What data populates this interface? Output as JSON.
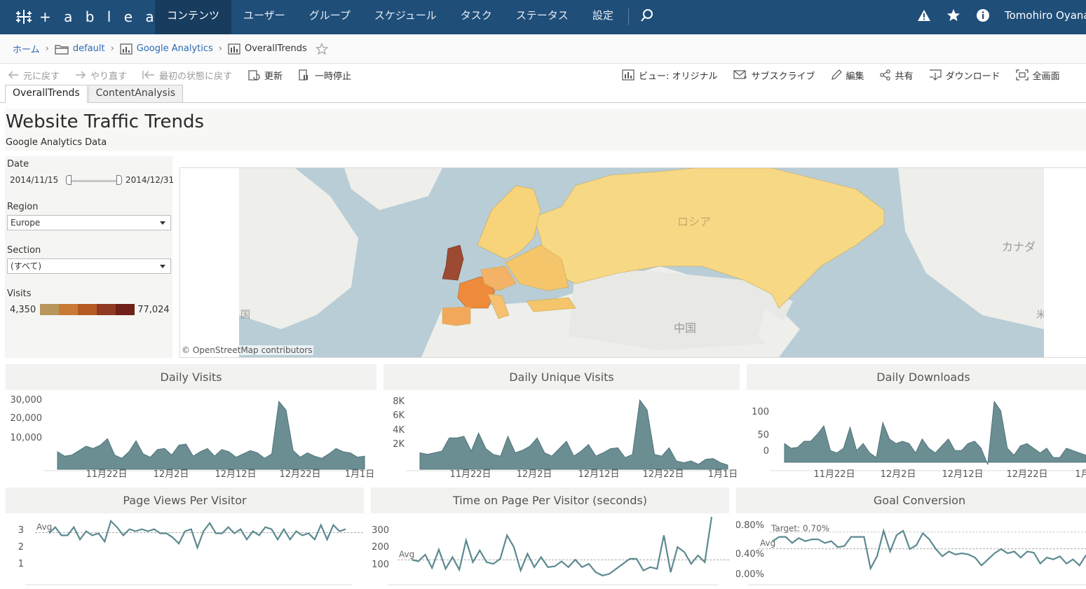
{
  "topnav": {
    "logo_text": "+ a b l e a u",
    "items": [
      {
        "label": "コンテンツ",
        "active": true
      },
      {
        "label": "ユーザー",
        "active": false
      },
      {
        "label": "グループ",
        "active": false
      },
      {
        "label": "スケジュール",
        "active": false
      },
      {
        "label": "タスク",
        "active": false
      },
      {
        "label": "ステータス",
        "active": false
      },
      {
        "label": "設定",
        "active": false
      }
    ],
    "user_name": "Tomohiro Oyana",
    "colors": {
      "bar": "#1f4e79",
      "active": "#173c5e"
    }
  },
  "breadcrumb": {
    "home": "ホーム",
    "project": "default",
    "workbook": "Google Analytics",
    "view": "OverallTrends"
  },
  "toolbar": {
    "undo": "元に戻す",
    "redo": "やり直す",
    "revert": "最初の状態に戻す",
    "refresh": "更新",
    "pause": "一時停止",
    "view": "ビュー: オリジナル",
    "subscribe": "サブスクライブ",
    "edit": "編集",
    "share": "共有",
    "download": "ダウンロード",
    "fullscreen": "全画面"
  },
  "tabs": [
    "OverallTrends",
    "ContentAnalysis"
  ],
  "dashboard": {
    "title": "Website Traffic Trends",
    "subtitle": "Google Analytics Data",
    "filters": {
      "date_label": "Date",
      "date_start": "2014/11/15",
      "date_end": "2014/12/31",
      "region_label": "Region",
      "region_value": "Europe",
      "section_label": "Section",
      "section_value": "(すべて)",
      "visits_label": "Visits",
      "visits_min": "4,350",
      "visits_max": "77,024",
      "legend_colors": [
        "#b8955a",
        "#c97a36",
        "#b55a25",
        "#8f3a22",
        "#6e2019"
      ]
    },
    "map": {
      "credit": "© OpenStreetMap contributors",
      "labels": {
        "russia": "ロシア",
        "china": "中国",
        "canada": "カナダ",
        "country_partial": "国",
        "partial_rus": "米"
      }
    }
  },
  "chart_data": [
    {
      "type": "area",
      "title": "Daily Visits",
      "xticks": [
        "11月22日",
        "12月2日",
        "12月12日",
        "12月22日",
        "1月1日"
      ],
      "yticks": [
        "30,000",
        "20,000",
        "10,000"
      ],
      "ylim": [
        0,
        32000
      ],
      "values": [
        8000,
        6000,
        6500,
        8500,
        10500,
        9500,
        11000,
        14000,
        6500,
        5000,
        8000,
        13000,
        7000,
        5500,
        9000,
        9500,
        6500,
        11000,
        11500,
        6000,
        8000,
        9500,
        6000,
        9000,
        8000,
        5500,
        7000,
        8500,
        7500,
        5000,
        7000,
        31000,
        27000,
        8500,
        5500,
        7500,
        6000,
        5000,
        7000,
        9500,
        8000,
        7500,
        5500,
        6000
      ]
    },
    {
      "type": "area",
      "title": "Daily Unique Visits",
      "xticks": [
        "11月22日",
        "12月2日",
        "12月12日",
        "12月22日",
        "1月1日"
      ],
      "yticks": [
        "8K",
        "6K",
        "4K",
        "2K"
      ],
      "ylim": [
        0,
        8500
      ],
      "values": [
        2000,
        1800,
        2000,
        2200,
        3800,
        3800,
        4000,
        2200,
        4400,
        2500,
        1800,
        1600,
        4000,
        2000,
        2300,
        2800,
        3800,
        2000,
        1600,
        2500,
        3400,
        1600,
        2200,
        3000,
        1600,
        2000,
        2500,
        2600,
        1400,
        1800,
        8400,
        7200,
        1800,
        1600,
        2600,
        1000,
        800,
        1000,
        600,
        1200,
        1300,
        800,
        500
      ]
    },
    {
      "type": "area",
      "title": "Daily Downloads",
      "xticks": [
        "11月22日",
        "12月2日",
        "12月12日",
        "12月22日",
        "1月"
      ],
      "yticks": [
        "100",
        "50",
        "0"
      ],
      "ylim": [
        -15,
        135
      ],
      "values": [
        40,
        30,
        32,
        45,
        45,
        60,
        78,
        25,
        20,
        30,
        75,
        25,
        40,
        20,
        10,
        85,
        50,
        40,
        45,
        40,
        20,
        50,
        30,
        20,
        35,
        50,
        25,
        25,
        40,
        45,
        30,
        -5,
        130,
        110,
        30,
        15,
        35,
        40,
        30,
        20,
        30,
        10,
        10,
        30,
        25,
        20,
        15
      ]
    },
    {
      "type": "line",
      "title": "Page Views Per Visitor",
      "yticks": [
        "3",
        "2",
        "1"
      ],
      "ylim": [
        0.6,
        3.7
      ],
      "avg_label": "Avg",
      "values": [
        2.9,
        3.2,
        2.8,
        2.8,
        3.2,
        2.6,
        3.0,
        2.8,
        2.9,
        2.5,
        3.5,
        3.2,
        2.8,
        3.1,
        3.0,
        3.1,
        3.0,
        3.1,
        2.9,
        2.9,
        2.7,
        2.4,
        3.0,
        3.1,
        2.2,
        3.0,
        3.4,
        2.9,
        2.9,
        3.2,
        2.9,
        3.1,
        2.6,
        3.0,
        2.8,
        3.2,
        3.1,
        2.6,
        3.1,
        2.6,
        3.0,
        2.8,
        2.9,
        2.6,
        3.3,
        2.6,
        3.3,
        3.0,
        3.1
      ]
    },
    {
      "type": "line",
      "title": "Time on Page Per Visitor (seconds)",
      "yticks": [
        "300",
        "200",
        "100"
      ],
      "ylim": [
        10,
        390
      ],
      "avg_label": "Avg",
      "values": [
        135,
        125,
        165,
        85,
        195,
        80,
        150,
        75,
        250,
        120,
        190,
        120,
        110,
        140,
        280,
        210,
        70,
        170,
        90,
        150,
        90,
        95,
        125,
        90,
        135,
        90,
        110,
        60,
        40,
        50,
        80,
        110,
        140,
        140,
        70,
        90,
        80,
        280,
        60,
        210,
        180,
        110,
        160,
        120,
        390
      ]
    },
    {
      "type": "line",
      "title": "Goal Conversion",
      "yticks": [
        "0.80%",
        "0.40%",
        "0.00%"
      ],
      "ylim": [
        -0.1,
        0.95
      ],
      "target_label": "Target: 0.70%",
      "avg_label": "Avg",
      "values": [
        0.55,
        0.62,
        0.62,
        0.52,
        0.6,
        0.55,
        0.58,
        0.58,
        0.52,
        0.55,
        0.45,
        0.47,
        0.62,
        0.62,
        0.62,
        0.1,
        0.3,
        0.72,
        0.38,
        0.65,
        0.72,
        0.42,
        0.48,
        0.68,
        0.58,
        0.42,
        0.3,
        0.38,
        0.33,
        0.35,
        0.33,
        0.28,
        0.15,
        0.25,
        0.35,
        0.42,
        0.35,
        0.38,
        0.28,
        0.38,
        0.36,
        0.18,
        0.28,
        0.25,
        0.3,
        0.18,
        0.25,
        0.15,
        0.32
      ]
    }
  ]
}
